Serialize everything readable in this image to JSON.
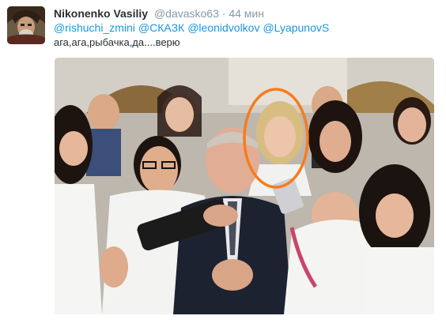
{
  "tweet": {
    "author_name": "Nikonenko Vasiliy",
    "handle": "@davasko63",
    "separator": "·",
    "timestamp": "44 мин",
    "mentions": [
      "@rishuchi_zmini",
      "@СКАЗК",
      "@leonidvolkov",
      "@LyapunovS"
    ],
    "text": "ага,ага,рыбачка,да....верю"
  },
  "media": {
    "avatar_icon": "user-avatar-photo",
    "photo_icon": "group-selfie-photo",
    "highlight_color": "#f57c1f"
  },
  "colors": {
    "link": "#1b95e0",
    "name": "#292f33",
    "meta": "#8899a6"
  }
}
